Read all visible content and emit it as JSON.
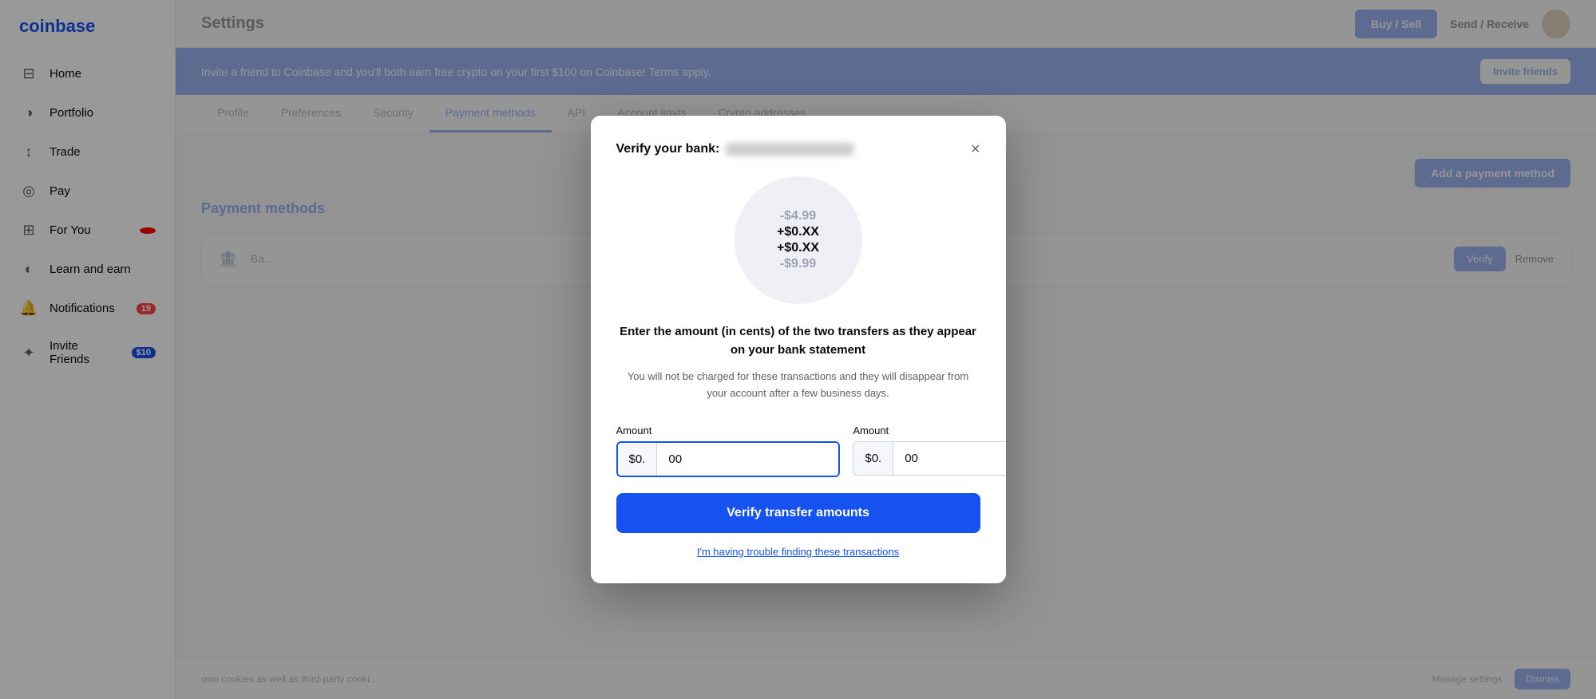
{
  "app": {
    "logo": "coinbase",
    "brand_color": "#1652f0"
  },
  "sidebar": {
    "items": [
      {
        "id": "home",
        "label": "Home",
        "icon": "⊟",
        "badge": null
      },
      {
        "id": "portfolio",
        "label": "Portfolio",
        "icon": "◑",
        "badge": null
      },
      {
        "id": "trade",
        "label": "Trade",
        "icon": "↕",
        "badge": null
      },
      {
        "id": "pay",
        "label": "Pay",
        "icon": "◎",
        "badge": null
      },
      {
        "id": "for-you",
        "label": "For You",
        "icon": "⊞",
        "badge": "•"
      },
      {
        "id": "learn-and-earn",
        "label": "Learn and earn",
        "icon": "◐",
        "badge": null
      },
      {
        "id": "notifications",
        "label": "Notifications",
        "icon": "🔔",
        "badge": "19"
      },
      {
        "id": "invite-friends",
        "label": "Invite Friends",
        "icon": "✦",
        "badge": "$10"
      }
    ]
  },
  "topbar": {
    "title": "Settings",
    "buy_sell_label": "Buy / Sell",
    "send_receive_label": "Send / Receive"
  },
  "banner": {
    "text": "Invite a friend to Coinbase and you'll both earn free crypto on your first $100 on Coinbase! Terms apply.",
    "invite_label": "Invite friends"
  },
  "settings_tabs": {
    "tabs": [
      {
        "id": "profile",
        "label": "Profile"
      },
      {
        "id": "preferences",
        "label": "Preferences"
      },
      {
        "id": "security",
        "label": "Security"
      },
      {
        "id": "payment-methods",
        "label": "Payment methods",
        "active": true
      },
      {
        "id": "api",
        "label": "API"
      },
      {
        "id": "account-limits",
        "label": "Account limits"
      },
      {
        "id": "crypto-addresses",
        "label": "Crypto addresses"
      }
    ]
  },
  "payment_methods": {
    "section_title": "Payment methods",
    "add_button_label": "Add a payment method",
    "bank_name": "Ba...",
    "verify_label": "Verify",
    "remove_label": "Remove"
  },
  "cookie_bar": {
    "text": "own cookies as well as third-party cooki...",
    "manage_label": "Manage settings",
    "dismiss_label": "Dismiss"
  },
  "modal": {
    "title_prefix": "Verify your bank:",
    "title_blurred": "••••••••••••••",
    "close_label": "×",
    "circle_amounts": [
      {
        "value": "-$4.99",
        "type": "negative"
      },
      {
        "value": "+$0.XX",
        "type": "positive"
      },
      {
        "value": "+$0.XX",
        "type": "positive"
      },
      {
        "value": "-$9.99",
        "type": "negative"
      }
    ],
    "desc_main": "Enter the amount (in cents) of the two transfers as they appear on your bank statement",
    "desc_sub": "You will not be charged for these transactions and they will disappear from your account after a few business days.",
    "amount1_label": "Amount",
    "amount1_prefix": "$0.",
    "amount1_value": "00",
    "amount2_label": "Amount",
    "amount2_prefix": "$0.",
    "amount2_value": "00",
    "verify_button_label": "Verify transfer amounts",
    "trouble_link_label": "I'm having trouble finding these transactions"
  }
}
